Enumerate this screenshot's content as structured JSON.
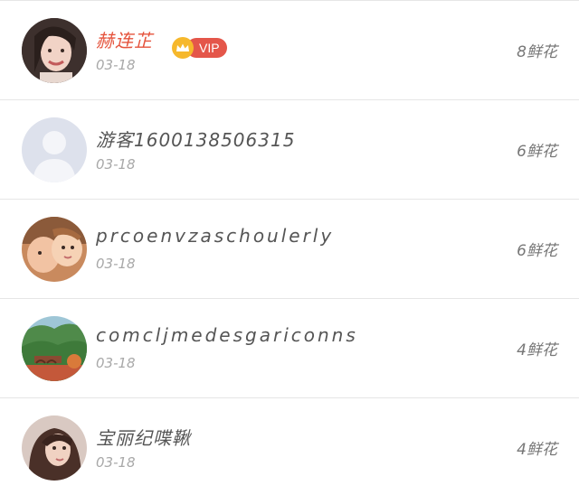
{
  "users": [
    {
      "name": "赫连芷",
      "date": "03-18",
      "flowers": "8鲜花",
      "vip": "VIP",
      "avatar": "woman-smiling-avatar"
    },
    {
      "name": "游客1600138506315",
      "date": "03-18",
      "flowers": "6鲜花",
      "avatar": "default-avatar"
    },
    {
      "name": "prcoenvzaschoulerly",
      "date": "03-18",
      "flowers": "6鲜花",
      "avatar": "babies-avatar"
    },
    {
      "name": "comcljmedesgariconns",
      "date": "03-18",
      "flowers": "4鲜花",
      "avatar": "landscape-bridge-avatar"
    },
    {
      "name": "宝丽纪喋鞦",
      "date": "03-18",
      "flowers": "4鲜花",
      "avatar": "girl-portrait-avatar"
    }
  ],
  "colors": {
    "vip_name": "#e5533c",
    "vip_badge": "#e4564a",
    "crown": "#f6b82c",
    "divider": "#e6e6e6"
  }
}
